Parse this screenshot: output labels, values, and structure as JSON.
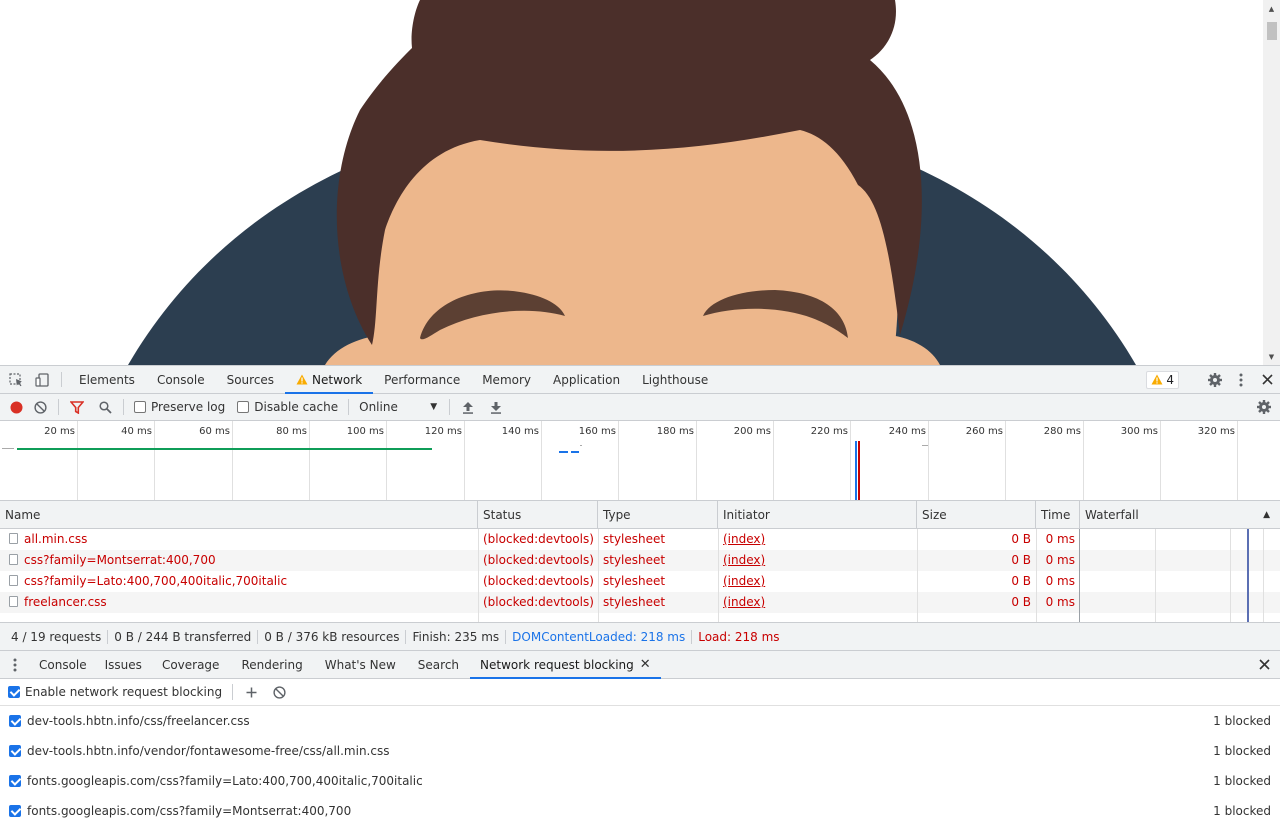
{
  "devtools": {
    "main_tabs": [
      {
        "label": "Elements",
        "active": false
      },
      {
        "label": "Console",
        "active": false
      },
      {
        "label": "Sources",
        "active": false
      },
      {
        "label": "Network",
        "active": true,
        "warning": true
      },
      {
        "label": "Performance",
        "active": false
      },
      {
        "label": "Memory",
        "active": false
      },
      {
        "label": "Application",
        "active": false
      },
      {
        "label": "Lighthouse",
        "active": false
      }
    ],
    "warning_count": "4",
    "toolbar": {
      "preserve_log": "Preserve log",
      "disable_cache": "Disable cache",
      "throttle_value": "Online"
    },
    "overview_ticks": [
      "20 ms",
      "40 ms",
      "60 ms",
      "80 ms",
      "100 ms",
      "120 ms",
      "140 ms",
      "160 ms",
      "180 ms",
      "200 ms",
      "220 ms",
      "240 ms",
      "260 ms",
      "280 ms",
      "300 ms",
      "320 ms"
    ],
    "table": {
      "columns": [
        "Name",
        "Status",
        "Type",
        "Initiator",
        "Size",
        "Time",
        "Waterfall"
      ],
      "rows": [
        {
          "name": "all.min.css",
          "status": "(blocked:devtools)",
          "type": "stylesheet",
          "initiator": "(index)",
          "size": "0 B",
          "time": "0 ms"
        },
        {
          "name": "css?family=Montserrat:400,700",
          "status": "(blocked:devtools)",
          "type": "stylesheet",
          "initiator": "(index)",
          "size": "0 B",
          "time": "0 ms"
        },
        {
          "name": "css?family=Lato:400,700,400italic,700italic",
          "status": "(blocked:devtools)",
          "type": "stylesheet",
          "initiator": "(index)",
          "size": "0 B",
          "time": "0 ms"
        },
        {
          "name": "freelancer.css",
          "status": "(blocked:devtools)",
          "type": "stylesheet",
          "initiator": "(index)",
          "size": "0 B",
          "time": "0 ms"
        }
      ]
    },
    "status": {
      "requests": "4 / 19 requests",
      "transferred": "0 B / 244 B transferred",
      "resources": "0 B / 376 kB resources",
      "finish": "Finish: 235 ms",
      "dcl": "DOMContentLoaded: 218 ms",
      "load": "Load: 218 ms"
    },
    "drawer_tabs": [
      {
        "label": "Console",
        "active": false
      },
      {
        "label": "Issues",
        "active": false
      },
      {
        "label": "Coverage",
        "active": false
      },
      {
        "label": "Rendering",
        "active": false
      },
      {
        "label": "What's New",
        "active": false
      },
      {
        "label": "Search",
        "active": false
      },
      {
        "label": "Network request blocking",
        "active": true
      }
    ],
    "blocking": {
      "enable_label": "Enable network request blocking",
      "patterns": [
        {
          "pattern": "dev-tools.hbtn.info/css/freelancer.css",
          "count": "1 blocked"
        },
        {
          "pattern": "dev-tools.hbtn.info/vendor/fontawesome-free/css/all.min.css",
          "count": "1 blocked"
        },
        {
          "pattern": "fonts.googleapis.com/css?family=Lato:400,700,400italic,700italic",
          "count": "1 blocked"
        },
        {
          "pattern": "fonts.googleapis.com/css?family=Montserrat:400,700",
          "count": "1 blocked"
        }
      ]
    }
  },
  "colors": {
    "hair": "#4b2f2a",
    "skin": "#edb78c",
    "shirt": "#2c3e50",
    "brow": "#5c4033",
    "accent": "#1a73e8",
    "error": "#c80000"
  }
}
